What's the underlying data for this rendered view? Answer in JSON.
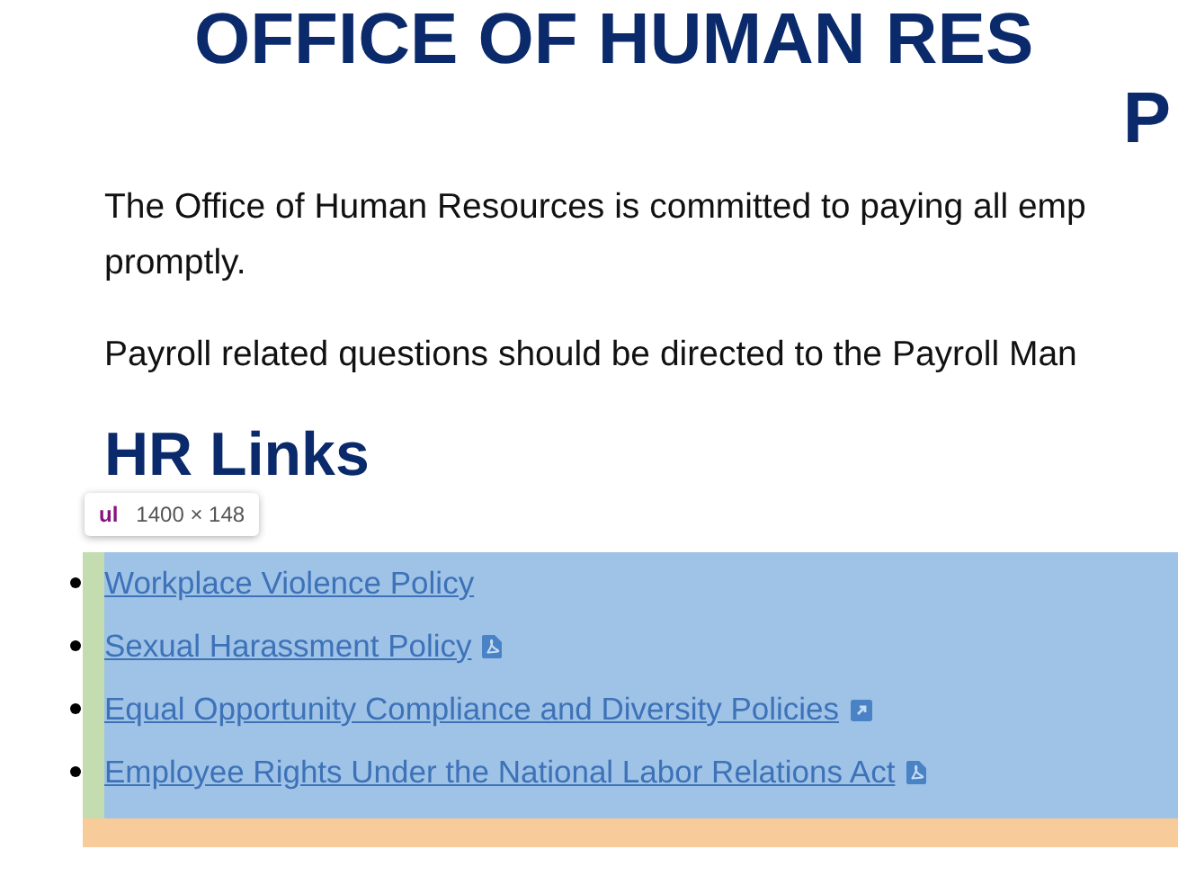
{
  "title": {
    "lines": [
      "OFFICE OF HUMAN RES",
      "P"
    ]
  },
  "paragraphs": [
    "The Office of Human Resources is committed to paying all emp",
    "promptly.",
    "Payroll related questions should be directed to the Payroll Man"
  ],
  "section_heading": "HR Links",
  "inspector_tooltip": {
    "tag": "ul",
    "size": "1400 × 148"
  },
  "links": [
    {
      "label": "Workplace Violence Policy",
      "kind": "plain"
    },
    {
      "label": "Sexual Harassment Policy",
      "kind": "pdf"
    },
    {
      "label": "Equal Opportunity Compliance and Diversity Policies",
      "kind": "external"
    },
    {
      "label": "Employee Rights Under the National Labor Relations Act",
      "kind": "pdf"
    }
  ]
}
